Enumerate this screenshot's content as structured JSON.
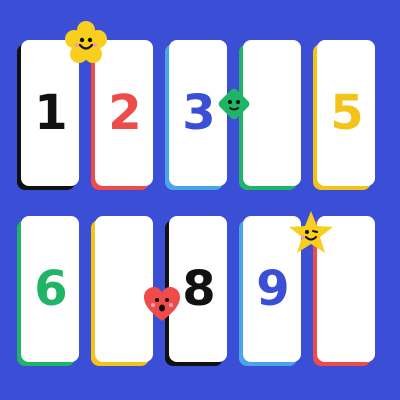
{
  "board": {
    "background": "#3a4fd6",
    "rows": [
      [
        {
          "label": "1",
          "color": "#111111",
          "shadow": "#111111"
        },
        {
          "label": "2",
          "color": "#ef4b4b",
          "shadow": "#ef4b4b"
        },
        {
          "label": "3",
          "color": "#3a4fd6",
          "shadow": "#4aa6ea"
        },
        {
          "label": "",
          "color": "#1fb466",
          "shadow": "#1fb466"
        },
        {
          "label": "5",
          "color": "#f3c318",
          "shadow": "#f3c318"
        }
      ],
      [
        {
          "label": "6",
          "color": "#1fb466",
          "shadow": "#1fb466"
        },
        {
          "label": "",
          "color": "#f3c318",
          "shadow": "#f3c318"
        },
        {
          "label": "8",
          "color": "#111111",
          "shadow": "#111111"
        },
        {
          "label": "9",
          "color": "#3a4fd6",
          "shadow": "#4aa6ea"
        },
        {
          "label": "",
          "color": "#ef4b4b",
          "shadow": "#ef4b4b"
        }
      ]
    ]
  },
  "mascots": [
    {
      "name": "yellow-flower-mascot-icon",
      "color": "#f7cf1c"
    },
    {
      "name": "green-diamond-mascot-icon",
      "color": "#1fb466"
    },
    {
      "name": "yellow-star-mascot-icon",
      "color": "#f7cf1c"
    },
    {
      "name": "red-heart-mascot-icon",
      "color": "#ef4b4b"
    }
  ]
}
